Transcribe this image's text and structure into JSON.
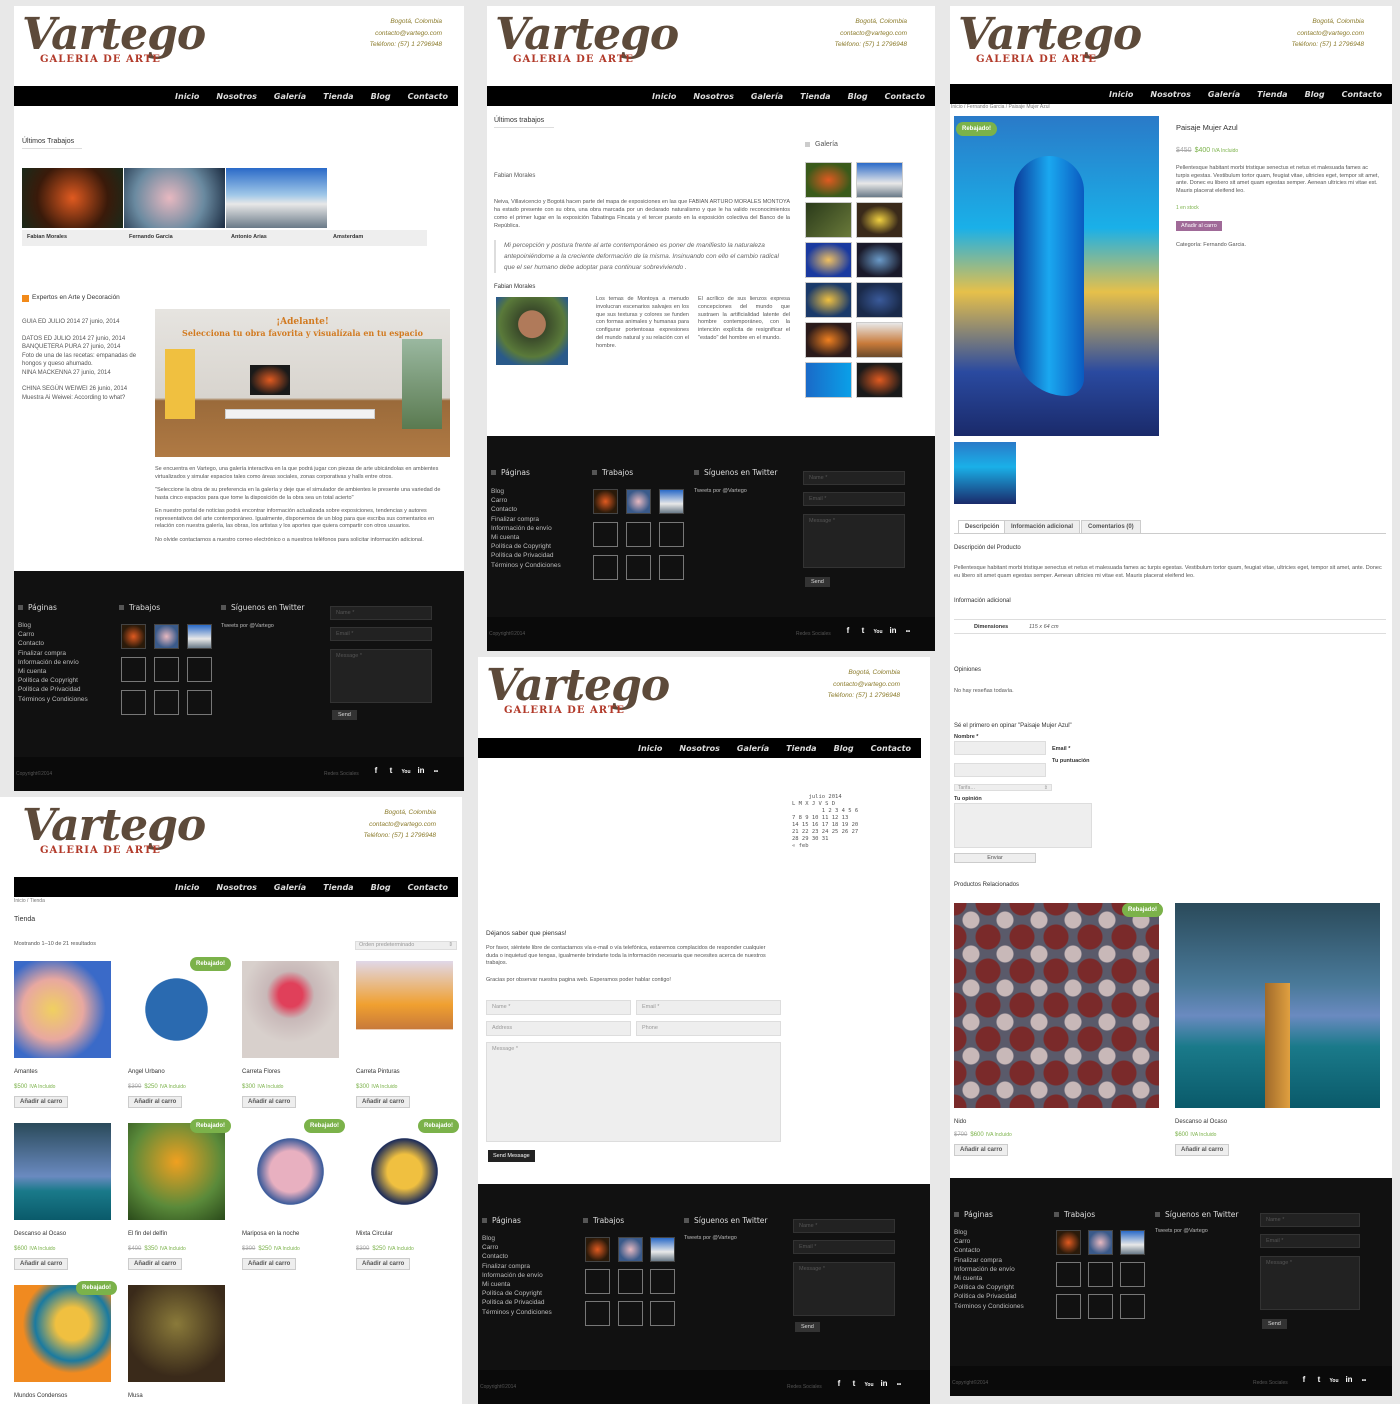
{
  "site": {
    "logo_word": "Vartego",
    "logo_sub": "GALERIA DE ARTE",
    "city": "Bogotá, Colombia",
    "email": "contacto@vartego.com",
    "phone": "Teléfono: (57) 1 2796948",
    "nav": [
      "Inicio",
      "Nosotros",
      "Galería",
      "Tienda",
      "Blog",
      "Contacto"
    ]
  },
  "footer": {
    "pages_title": "Páginas",
    "pages": [
      "Blog",
      "Carro",
      "Contacto",
      "Finalizar compra",
      "Información de envío",
      "Mi cuenta",
      "Política de Copyright",
      "Política de Privacidad",
      "Términos y Condiciones"
    ],
    "works_title": "Trabajos",
    "twitter_title": "Síguenos en Twitter",
    "tweets": "Tweets por @Vartego",
    "name_ph": "Name *",
    "email_ph": "Email *",
    "message_ph": "Message *",
    "send": "Send",
    "copyright": "Copyright©2014",
    "social_label": "Redes Sociales",
    "social": [
      "f",
      "t",
      "You",
      "in",
      "••"
    ]
  },
  "home": {
    "latest": "Últimos Trabajos",
    "works": [
      "Fabian Morales",
      "Fernando Garcia",
      "Antonio Arias",
      "Amsterdam"
    ],
    "rss_title": "Expertos en Arte y Decoración",
    "posts": [
      {
        "title": "GUIA ED JULIO 2014",
        "date": "27 junio, 2014",
        "excerpt": ""
      },
      {
        "title": "DATOS ED JULIO 2014",
        "date": "27 junio, 2014",
        "excerpt": ""
      },
      {
        "title": "BANQUETERA PURA",
        "date": "27 junio, 2014",
        "excerpt": "Foto de una de las recetas: empanadas de hongos y queso ahumado."
      },
      {
        "title": "NINA MACKENNA",
        "date": "27 junio, 2014",
        "excerpt": ""
      },
      {
        "title": "CHINA SEGÚN WEIWEI",
        "date": "26 junio, 2014",
        "excerpt": "Muestra Ai Weiwei: According to what?"
      }
    ],
    "banner_1": "¡Adelante!",
    "banner_2": "Selecciona tu obra favorita y visualízala en tu espacio",
    "p1": "Se encuentra en Vartego, una galería interactiva en la que podrá jugar con piezas de arte ubicándolas en ambientes virtualizados y simular espacios tales como áreas sociales, zonas corporativas y halls entre otros.",
    "p2": "\"Seleccione la obra de su preferencia en la galería y deje que el simulador de ambientes le presente una variedad de hasta cinco espacios para que tome la disposición de la obra sea un total acierto\"",
    "p3": "En nuestro portal de noticias podrá encontrar información actualizada sobre exposiciones, tendencias y autores representativos del arte contemporáneo. Igualmente, disponemos de un blog para que escriba sus comentarios en relación con nuestra galería, las obras, los artistas y los aportes que quiera compartir con otros usuarios.",
    "p4": "No olvide contactarnos a nuestro correo electrónico o a nuestros teléfonos para solicitar información adicional."
  },
  "artist": {
    "latest": "Últimos trabajos",
    "name": "Fabian Morales",
    "bio": "Neiva, Villavicencio y Bogotá hacen parte del mapa de exposiciones en las que FABIAN ARTURO MORALES MONTOYA ha estado presente con su obra, una obra marcada por un declarado naturalismo y que le ha valido reconocimientos como el primer lugar en la exposición Tabatinga Fincata y el tercer puesto en la exposición colectiva del Banco de la República.",
    "quote": "Mi percepción y postura frente al arte contemporáneo es poner de manifiesto la naturaleza antepoiniéndome a la creciente deformación de la misma. Insinuando con ello el cambio radical que el ser humano debe adoptar para continuar sobreviviendo .",
    "name2": "Fabian Morales",
    "col1": "Los temas de Montoya a menudo involucran escenarios salvajes en los que sus texturas y colores se funden con formas animales y humanas para configurar portentosas expresiones del mundo natural y su relación con el hombre.",
    "col2": "El acrílico de sus lienzos expresa concepciones del mundo que sustraen la artificialidad latente del hombre contemporáneo, con la intención explícita de resignificar el \"estado\" del hombre en el mundo.",
    "gallery": "Galería"
  },
  "product": {
    "breadcrumb": "Inicio / Fernando Garcia / Paisaje Mujer Azul",
    "sale": "Rebajado!",
    "title": "Paisaje Mujer Azul",
    "old_price": "$450",
    "price": "$400",
    "tax": "IVA Incluido",
    "desc": "Pellentesque habitant morbi tristique senectus et netus et malesuada fames ac turpis egestas. Vestibulum tortor quam, feugiat vitae, ultricies eget, tempor sit amet, ante. Donec eu libero sit amet quam egestas semper. Aenean ultricies mi vitae est. Mauris placerat eleifend leo.",
    "stock": "1 en stock",
    "add": "Añadir al carro",
    "category": "Categoría: Fernando Garcia.",
    "tabs": [
      "Descripción",
      "Información adicional",
      "Comentarios (0)"
    ],
    "desc_title": "Descripción del Producto",
    "desc_long": "Pellentesque habitant morbi tristique senectus et netus et malesuada fames ac turpis egestas. Vestibulum tortor quam, feugiat vitae, ultricies eget, tempor sit amet, ante. Donec eu libero sit amet quam egestas semper. Aenean ultricies mi vitae est. Mauris placerat eleifend leo.",
    "info_title": "Información adicional",
    "dim_label": "Dimensiones",
    "dim_value": "115 x 64 cm",
    "reviews": "Opiniones",
    "no_reviews": "No hay reseñas todavía.",
    "first": "Sé el primero en opinar \"Paisaje Mujer Azul\"",
    "name_label": "Nombre *",
    "email_label": "Email *",
    "rating_label": "Tu puntuación",
    "rate_opt": "Tarifa…",
    "opinion_label": "Tu opinión",
    "send": "Enviar",
    "related": "Productos Relacionados",
    "rel": [
      {
        "name": "Nido",
        "old": "$700",
        "price": "$600",
        "sale": true
      },
      {
        "name": "Descanso al Ocaso",
        "old": "",
        "price": "$600",
        "sale": false
      }
    ]
  },
  "contact": {
    "month": "julio 2014",
    "days": "L M X J V S D",
    "rows": [
      "1 2 3 4 5 6",
      "7 8 9 10 11 12 13",
      "14 15 16 17 18 19 20",
      "21 22 23 24 25 26 27",
      "28 29 30 31"
    ],
    "prev": "« feb",
    "title": "Déjanos saber que piensas!",
    "p1": "Por favor, siéntete libre de contactarnos vía e-mail o vía telefónica, estaremos complacidos de responder cualquier duda o inquietud que tengas, igualmente brindarte toda la información necesaria que necesites acerca de nuestros trabajos.",
    "p2": "Gracias por observar nuestra pagina web.  Esperamos poder hablar contigo!",
    "name_ph": "Name *",
    "email_ph": "Email *",
    "address_ph": "Address",
    "phone_ph": "Phone",
    "message_ph": "Message *",
    "send": "Send Message"
  },
  "shop": {
    "breadcrumb": "Inicio / Tienda",
    "title": "Tienda",
    "count": "Mostrando 1–10 de 21 resultados",
    "order": "Orden predeterminado",
    "sale": "Rebajado!",
    "add": "Añadir al carro",
    "tax": "IVA Incluido",
    "items": [
      {
        "name": "Amantes",
        "old": "",
        "price": "$500",
        "sale": false
      },
      {
        "name": "Angel Urbano",
        "old": "$300",
        "price": "$250",
        "sale": true
      },
      {
        "name": "Carreta Flores",
        "old": "",
        "price": "$300",
        "sale": false
      },
      {
        "name": "Carreta Pinturas",
        "old": "",
        "price": "$300",
        "sale": false
      },
      {
        "name": "Descanso al Ocaso",
        "old": "",
        "price": "$600",
        "sale": false
      },
      {
        "name": "El fin del delfín",
        "old": "$400",
        "price": "$350",
        "sale": true
      },
      {
        "name": "Mariposa en la noche",
        "old": "$300",
        "price": "$250",
        "sale": true
      },
      {
        "name": "Mixta Circular",
        "old": "$300",
        "price": "$250",
        "sale": true
      },
      {
        "name": "Mundos Condensos",
        "old": "",
        "price": "",
        "sale": true
      },
      {
        "name": "Musa",
        "old": "",
        "price": "",
        "sale": false
      }
    ]
  },
  "colors": {
    "accent": "#7bb24a",
    "nav": "#000000",
    "footer": "#111111",
    "contact": "#8a7a2a"
  }
}
